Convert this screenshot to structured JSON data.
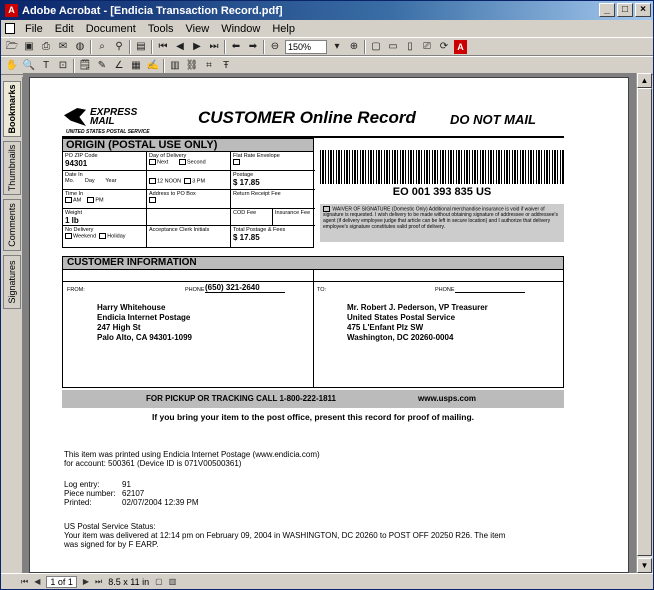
{
  "window": {
    "title": "Adobe Acrobat - [Endicia Transaction Record.pdf]",
    "app_icon": "A"
  },
  "menu": [
    "File",
    "Edit",
    "Document",
    "Tools",
    "View",
    "Window",
    "Help"
  ],
  "toolbar": {
    "zoom": "150%"
  },
  "sidetabs": [
    "Bookmarks",
    "Thumbnails",
    "Comments",
    "Signatures"
  ],
  "status": {
    "page": "1 of 1",
    "size": "8.5 x 11 in"
  },
  "label": {
    "brand_express": "EXPRESS",
    "brand_mail": "MAIL",
    "brand_sub": "UNITED STATES POSTAL SERVICE",
    "title": "CUSTOMER Online Record",
    "donotmail": "DO NOT MAIL",
    "origin_head": "ORIGIN (POSTAL USE ONLY)",
    "po_zip_label": "PO ZIP Code",
    "po_zip": "94301",
    "day_delivery_label": "Day of Delivery",
    "next": "Next",
    "second": "Second",
    "flat_rate_label": "Flat Rate Envelope",
    "date_in_label": "Date In",
    "mo": "Mo.",
    "day": "Day",
    "year": "Year",
    "noon": "12 NOON",
    "pm3": "3 PM",
    "postage_label": "Postage",
    "postage": "$ 17.85",
    "time_in_label": "Time In",
    "am": "AM",
    "pm": "PM",
    "po_box_label": "Address to PO Box",
    "return_fee_label": "Return Receipt Fee",
    "weight_label": "Weight",
    "weight": "1 lb",
    "cod_label": "COD Fee",
    "ins_label": "Insurance Fee",
    "no_delivery_label": "No Delivery",
    "weekend": "Weekend",
    "holiday": "Holiday",
    "clerk_label": "Acceptance Clerk Initials",
    "total_label": "Total Postage & Fees",
    "total": "$ 17.85",
    "tracking": "EO 001 393 835 US",
    "waiver_text": "WAIVER OF SIGNATURE (Domestic Only) Additional merchandise insurance is void if waiver of signature is requested. I wish delivery to be made without obtaining signature of addressee or addressee's agent (if delivery employee judge that article can be left in secure location) and I authorize that delivery employee's signature constitutes valid proof of delivery.",
    "cust_head": "CUSTOMER INFORMATION",
    "from_label": "FROM:",
    "phone_label": "PHONE",
    "from_phone": "(650) 321-2640",
    "to_label": "TO:",
    "from_addr": [
      "Harry Whitehouse",
      "Endicia Internet Postage",
      "247 High St",
      "Palo Alto, CA 94301-1099"
    ],
    "to_addr": [
      "Mr. Robert J. Pederson, VP Treasurer",
      "United States Postal Service",
      "475 L'Enfant Plz SW",
      "Washington, DC 20260-0004"
    ],
    "pickup": "FOR PICKUP OR TRACKING CALL 1-800-222-1811",
    "website": "www.usps.com",
    "proof": "If you bring your item to the post office, present this record for proof of mailing."
  },
  "info": {
    "printed_line1": "This item was printed using Endicia Internet Postage (www.endicia.com)",
    "printed_line2": "for account: 500361 (Device ID is 071V00500361)",
    "log_label": "Log entry:",
    "log_value": "91",
    "piece_label": "Piece number:",
    "piece_value": "62107",
    "printed_label": "Printed:",
    "printed_value": "02/07/2004 12:39 PM",
    "status_head": "US Postal Service Status:",
    "status_line1": "Your item was delivered at 12:14 pm on February 09, 2004 in WASHINGTON, DC 20260 to POST OFF 20250 R26. The item",
    "status_line2": "was signed for by F EARP."
  }
}
